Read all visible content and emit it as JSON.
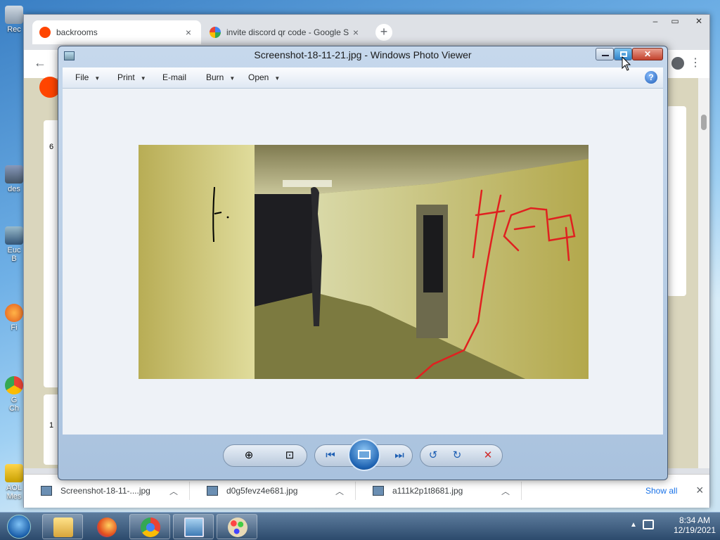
{
  "desktop": {
    "icons": [
      {
        "label": "Rec"
      },
      {
        "label": "des"
      },
      {
        "label": "Euc\nB"
      },
      {
        "label": "Fi"
      },
      {
        "label": "G\nCh"
      },
      {
        "label": "AOL\nMes"
      }
    ]
  },
  "chrome": {
    "tabs": [
      {
        "label": "backrooms",
        "close": "×"
      },
      {
        "label": "invite discord qr code - Google S",
        "close": "×"
      }
    ],
    "new_tab": "+",
    "downloads": [
      {
        "name": "Screenshot-18-11-....jpg"
      },
      {
        "name": "d0g5fevz4e681.jpg"
      },
      {
        "name": "a111k2p1t8681.jpg"
      }
    ],
    "show_all": "Show all",
    "close_shelf": "×",
    "vote_counts": [
      "6",
      "1"
    ]
  },
  "viewer": {
    "title": "Screenshot-18-11-21.jpg - Windows Photo Viewer",
    "menu": [
      "File",
      "Print",
      "E-mail",
      "Burn",
      "Open"
    ],
    "help": "?"
  },
  "taskbar": {
    "time": "8:34 AM",
    "date": "12/19/2021"
  },
  "colors": {
    "photo_wall": "#c8c27a",
    "drawing_red": "#e02020"
  }
}
